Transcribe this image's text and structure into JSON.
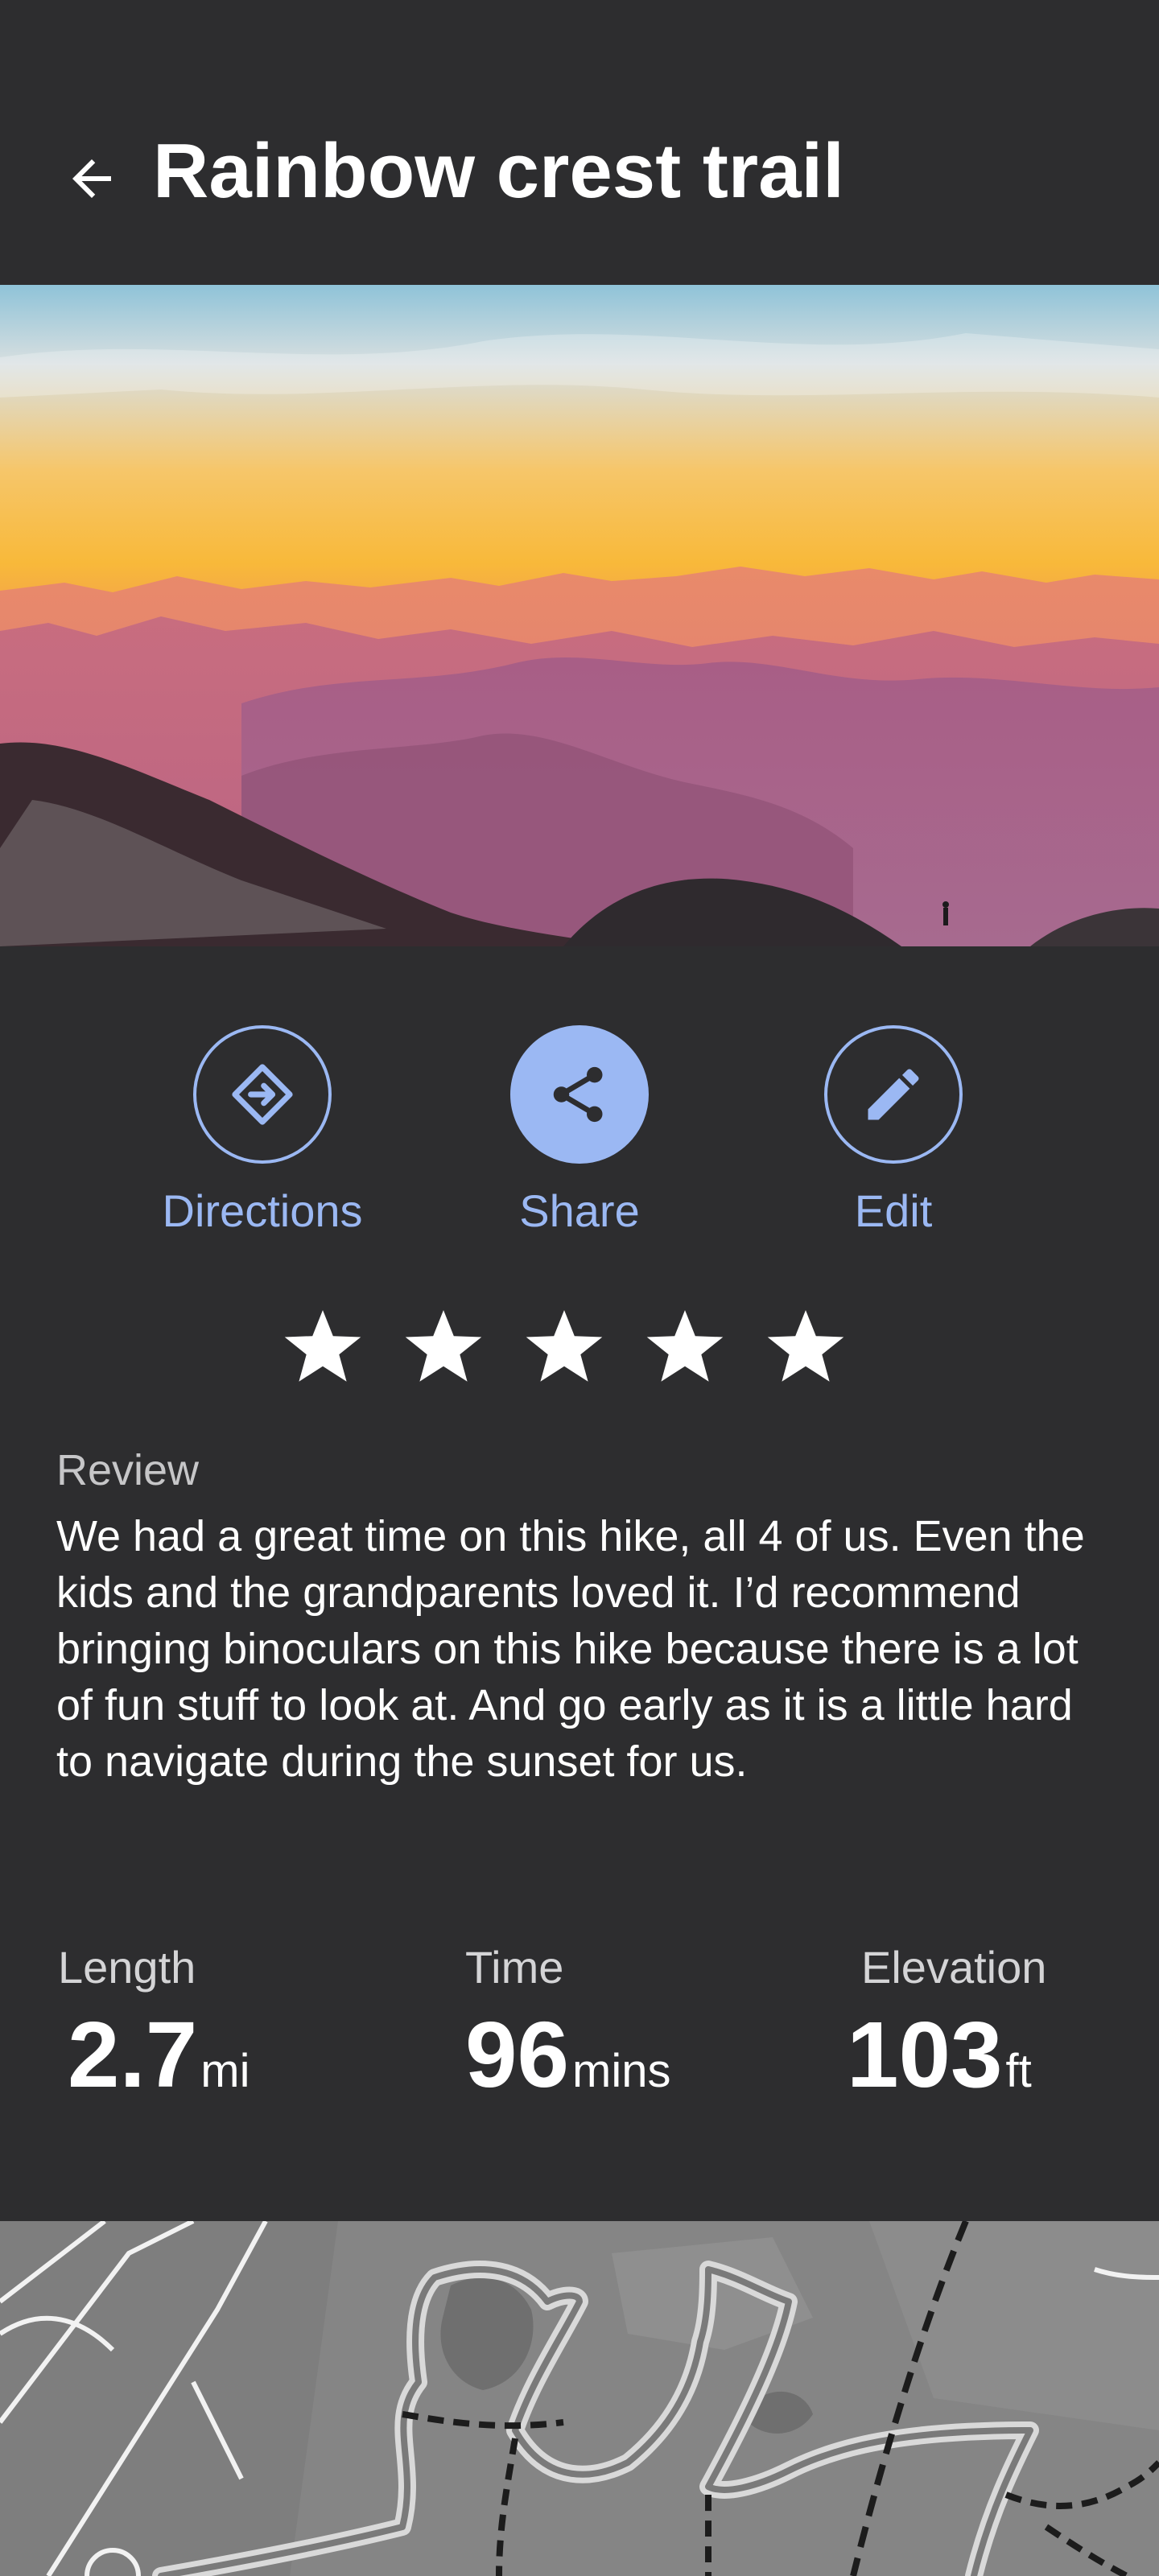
{
  "header": {
    "title": "Rainbow crest trail",
    "back_icon": "arrow-left-icon"
  },
  "hero": {
    "alt": "mountain-sunset-photo"
  },
  "actions": [
    {
      "label": "Directions",
      "icon": "directions-icon",
      "filled": false
    },
    {
      "label": "Share",
      "icon": "share-icon",
      "filled": true
    },
    {
      "label": "Edit",
      "icon": "edit-pencil-icon",
      "filled": false
    }
  ],
  "rating": {
    "stars": 5,
    "max": 5
  },
  "review": {
    "heading": "Review",
    "text": "We had a great time on this hike, all 4 of us.  Even the kids and the grandparents loved it.  I’d recommend bringing binoculars on this hike because there is a lot of fun stuff to look at.  And go early as it is a little hard to navigate during the sunset for us."
  },
  "stats": {
    "length": {
      "label": "Length",
      "value": "2.7",
      "unit": "mi"
    },
    "time": {
      "label": "Time",
      "value": "96",
      "unit": "mins"
    },
    "elevation": {
      "label": "Elevation",
      "value": "103",
      "unit": "ft"
    }
  },
  "colors": {
    "background": "#2d2d2f",
    "accent": "#9bb8f3",
    "text": "#ffffff"
  }
}
